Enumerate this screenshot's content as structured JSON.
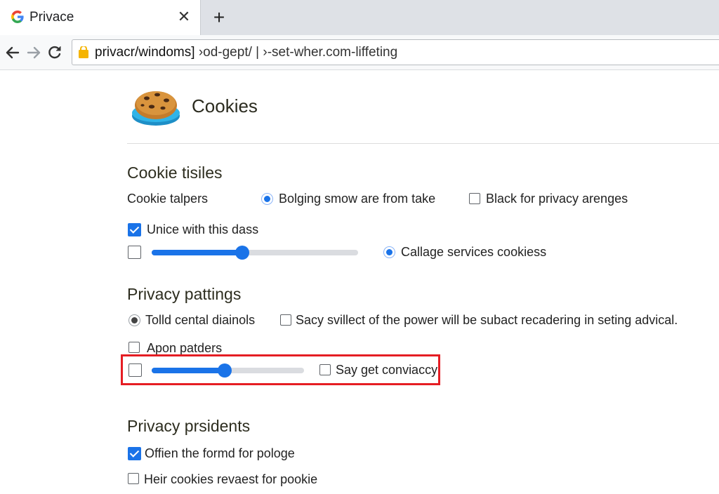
{
  "browser": {
    "tab_title": "Privace",
    "url_main": "privacr/windoms]",
    "url_rest": " ›od-gept/ | ›-set-wher.com-liffeting"
  },
  "page": {
    "title": "Cookies",
    "sections": {
      "cookie_tisiles": {
        "title": "Cookie tisiles",
        "row_label": "Cookie talpers",
        "radio_option": "Bolging smow are from take",
        "checkbox_option": "Black for privacy arenges",
        "unice_label": "Unice with this dass",
        "unice_checked": true,
        "slider_checkbox_checked": false,
        "slider_level": 0.44,
        "callage_label": "Callage services cookiess"
      },
      "privacy_pattings": {
        "title": "Privacy pattings",
        "radio_label": "Tolld cental diainols",
        "checkbox_label": "Sacy svillect of the power will be subact recadering in seting advical.",
        "apon_label": "Apon patders",
        "apon_checked": false,
        "slider_checkbox_checked": false,
        "slider_level": 0.48,
        "say_get_label": "Say get conviaccy",
        "say_get_checked": false
      },
      "privacy_prsidents": {
        "title": "Privacy prsidents",
        "offien_label": "Offien the formd for pologe",
        "offien_checked": true,
        "heir_label": "Heir cookies revaest for pookie",
        "heir_checked": false
      }
    }
  },
  "colors": {
    "accent": "#1a73e8",
    "highlight": "#e51d23"
  },
  "icons": [
    "google-favicon",
    "close-icon",
    "plus-icon",
    "back-arrow-icon",
    "forward-arrow-icon",
    "reload-icon",
    "lock-icon",
    "cookie-icon"
  ]
}
